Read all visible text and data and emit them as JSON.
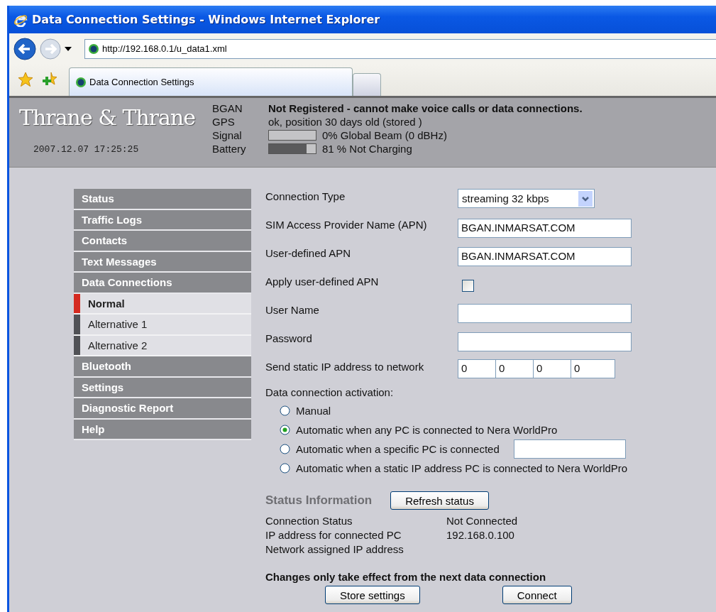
{
  "window": {
    "title": "Data Connection Settings - Windows Internet Explorer"
  },
  "toolbar": {
    "address": "http://192.168.0.1/u_data1.xml"
  },
  "tabs": [
    {
      "label": "Data Connection Settings",
      "selected": true
    },
    {
      "selected": false
    }
  ],
  "header": {
    "brand": "Thrane & Thrane",
    "datetime": "2007.12.07 17:25:25",
    "status": [
      {
        "label": "BGAN",
        "kind": "text",
        "value": "Not Registered - cannot make voice calls or data connections.",
        "bold": true
      },
      {
        "label": "GPS",
        "kind": "text",
        "value": "ok, position 30 days old (stored )",
        "bold": false
      },
      {
        "label": "Signal",
        "kind": "meter",
        "level": 0,
        "value": "0% Global Beam (0 dBHz)"
      },
      {
        "label": "Battery",
        "kind": "meter",
        "level": 0.81,
        "value": "81 % Not Charging"
      }
    ]
  },
  "sidebar": {
    "items": [
      {
        "label": "Status"
      },
      {
        "label": "Traffic Logs"
      },
      {
        "label": "Contacts"
      },
      {
        "label": "Text Messages"
      },
      {
        "label": "Data Connections",
        "children": [
          {
            "label": "Normal",
            "selected": true
          },
          {
            "label": "Alternative 1",
            "selected": false
          },
          {
            "label": "Alternative 2",
            "selected": false
          }
        ]
      },
      {
        "label": "Bluetooth"
      },
      {
        "label": "Settings"
      },
      {
        "label": "Diagnostic Report"
      },
      {
        "label": "Help"
      }
    ]
  },
  "form": {
    "fields": [
      {
        "kind": "select",
        "label": "Connection Type",
        "value": "streaming 32 kbps"
      },
      {
        "kind": "text",
        "label": "SIM Access Provider Name (APN)",
        "value": "BGAN.INMARSAT.COM"
      },
      {
        "kind": "text",
        "label": "User-defined APN",
        "value": "BGAN.INMARSAT.COM"
      },
      {
        "kind": "checkbox",
        "label": "Apply user-defined APN",
        "checked": false
      },
      {
        "kind": "text",
        "label": "User Name"
      },
      {
        "kind": "text",
        "label": "Password"
      },
      {
        "kind": "ip",
        "label": "Send static IP address to network",
        "values": [
          "0",
          "0",
          "0",
          "0"
        ]
      }
    ],
    "activation": {
      "label": "Data connection activation:",
      "options": [
        {
          "kind": "radio",
          "label": "Manual",
          "selected": false
        },
        {
          "kind": "radio",
          "label": "Automatic when any PC is connected to Nera WorldPro",
          "selected": true
        },
        {
          "kind": "radio_field",
          "label": "Automatic when a specific PC is connected",
          "selected": false
        },
        {
          "kind": "radio",
          "label": "Automatic when a static IP address PC is connected to Nera WorldPro",
          "selected": false
        }
      ]
    }
  },
  "status_info": {
    "title": "Status Information",
    "refresh_button": "Refresh status",
    "rows": [
      {
        "label": "Connection Status",
        "value": "Not Connected"
      },
      {
        "label": "IP address for connected PC",
        "value": "192.168.0.100"
      },
      {
        "label": "Network assigned IP address"
      }
    ]
  },
  "note": "Changes only take effect from the next data connection",
  "buttons": [
    "Store settings",
    "Connect"
  ]
}
